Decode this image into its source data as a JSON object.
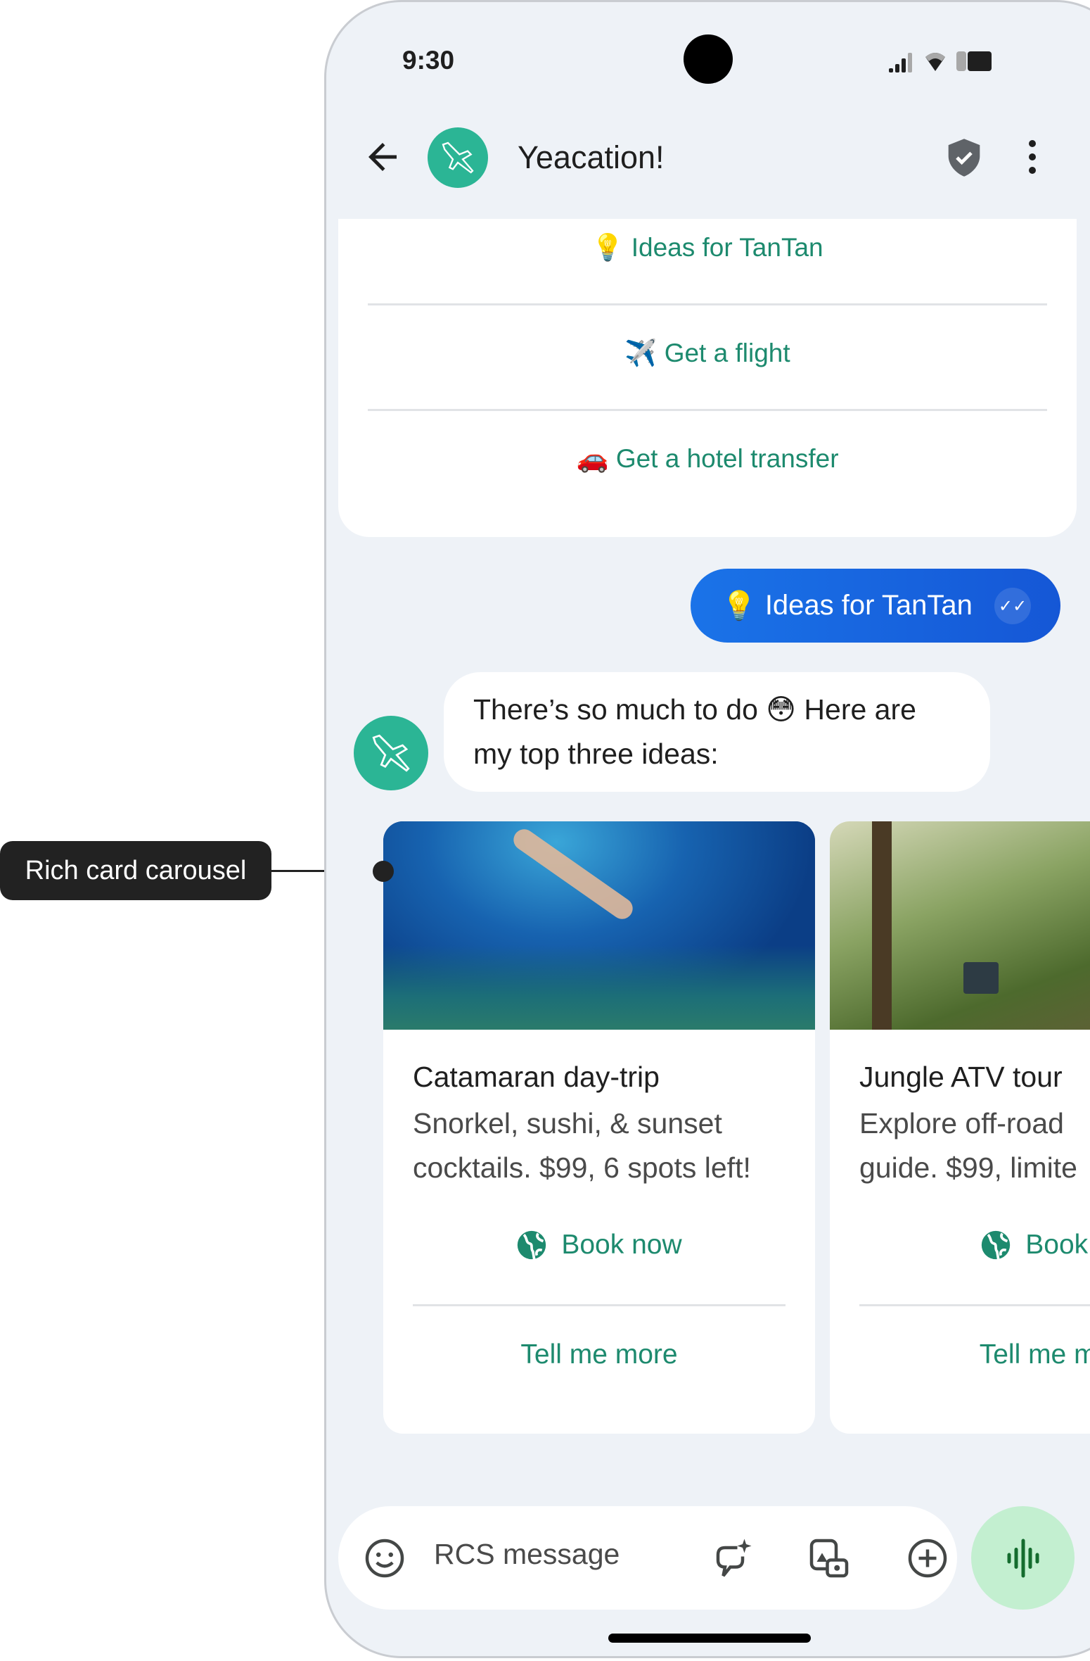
{
  "status_bar": {
    "time": "9:30"
  },
  "header": {
    "title": "Yeacation!",
    "back_icon": "arrow-back-icon",
    "avatar_icon": "airplane-icon",
    "verified_icon": "shield-check-icon",
    "more_icon": "more-vert-icon"
  },
  "suggestion_chips": [
    {
      "emoji": "💡",
      "label": "Ideas for TanTan"
    },
    {
      "emoji": "✈️",
      "label": "Get a flight"
    },
    {
      "emoji": "🚗",
      "label": "Get a hotel transfer"
    }
  ],
  "messages": {
    "sent": {
      "emoji": "💡",
      "text": "Ideas for TanTan",
      "status_icon": "double-check-icon"
    },
    "received": {
      "line1": "There’s so much to do 😳 Here are",
      "line2": "my top three ideas:"
    }
  },
  "carousel": {
    "cards": [
      {
        "title": "Catamaran day-trip",
        "desc_line1": "Snorkel, sushi, & sunset",
        "desc_line2": "cocktails. $99, 6 spots left!",
        "image": "snorkeler-underwater-image",
        "action1": "Book now",
        "action2": "Tell me more"
      },
      {
        "title": "Jungle ATV tour",
        "desc_line1": "Explore off-road",
        "desc_line2": "guide. $99, limite",
        "image": "jungle-road-jeeps-image",
        "action1": "Book n",
        "action2": "Tell me mo"
      }
    ]
  },
  "composer": {
    "placeholder": "RCS message"
  },
  "annotation": {
    "label": "Rich card carousel"
  },
  "colors": {
    "accent_green": "#1d8a6e",
    "avatar_teal": "#2bb595",
    "sent_blue": "#1a73e8",
    "mic_bg": "#c3efd0",
    "screen_bg": "#eef2f7"
  }
}
